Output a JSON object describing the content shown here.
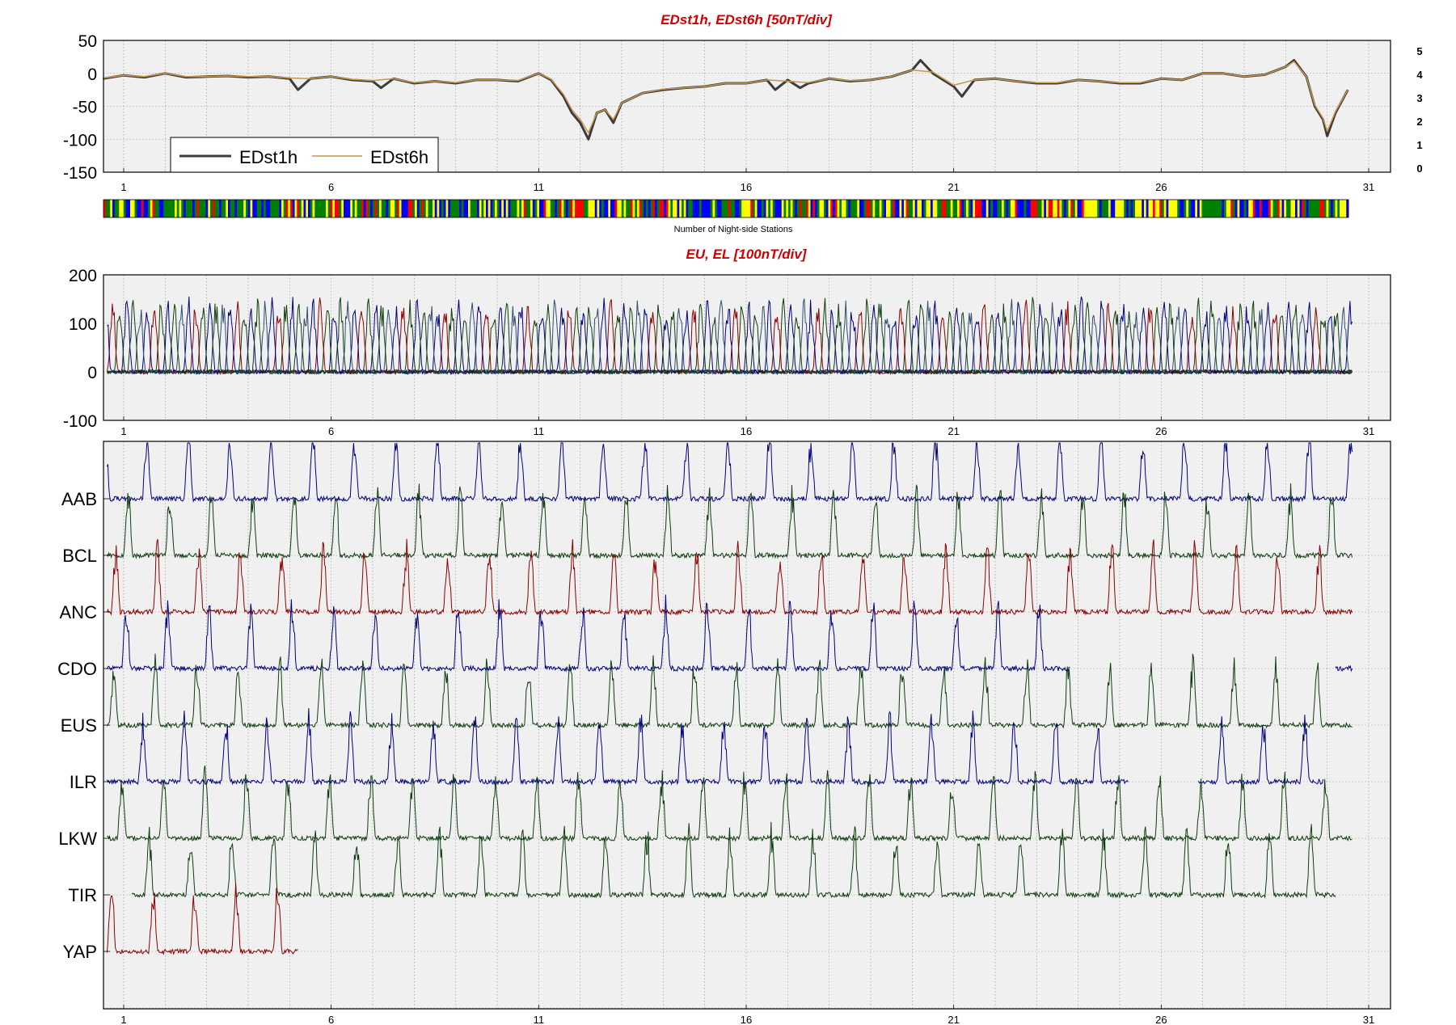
{
  "colors": {
    "frame": "#000000",
    "plot_bg": "#f0f0f0",
    "grid": "#8c8c8c",
    "title": "#d00000",
    "edst1h": "#3c3c3c",
    "edst6h": "#c8964b",
    "red_trace": "#8b0000",
    "blue_trace": "#000080",
    "green_trace": "#0f3d0f"
  },
  "chart_data": [
    {
      "id": "edst",
      "type": "line",
      "title": "EDst1h, EDst6h [50nT/div]",
      "xlabel": "",
      "ylabel": "",
      "xlim": [
        0,
        31
      ],
      "ylim": [
        -150,
        50
      ],
      "yticks": [
        50,
        0,
        -50,
        -100,
        -150
      ],
      "xticks": [
        1,
        6,
        11,
        16,
        21,
        26,
        31
      ],
      "grid": true,
      "legend": "bottom-left",
      "series": [
        {
          "name": "EDst1h",
          "color": "#3c3c3c",
          "x": [
            0.5,
            1,
            1.5,
            2,
            2.5,
            3,
            3.5,
            4,
            4.5,
            5,
            5.2,
            5.5,
            6,
            6.5,
            7,
            7.2,
            7.5,
            8,
            8.5,
            9,
            9.5,
            10,
            10.5,
            11,
            11.3,
            11.6,
            11.8,
            12,
            12.2,
            12.4,
            12.6,
            12.8,
            13,
            13.5,
            14,
            14.5,
            15,
            15.5,
            16,
            16.5,
            16.7,
            17,
            17.3,
            17.5,
            18,
            18.5,
            19,
            19.5,
            20,
            20.2,
            20.5,
            21,
            21.2,
            21.5,
            22,
            22.5,
            23,
            23.5,
            24,
            24.5,
            25,
            25.5,
            26,
            26.5,
            27,
            27.5,
            28,
            28.5,
            29,
            29.2,
            29.5,
            29.7,
            29.9,
            30,
            30.2,
            30.5
          ],
          "y": [
            -8,
            -3,
            -6,
            0,
            -6,
            -5,
            -4,
            -6,
            -5,
            -8,
            -25,
            -8,
            -5,
            -10,
            -12,
            -22,
            -8,
            -15,
            -12,
            -15,
            -10,
            -10,
            -12,
            0,
            -10,
            -35,
            -60,
            -75,
            -100,
            -60,
            -55,
            -75,
            -45,
            -30,
            -25,
            -22,
            -20,
            -15,
            -15,
            -10,
            -25,
            -10,
            -22,
            -15,
            -8,
            -12,
            -10,
            -5,
            5,
            20,
            0,
            -20,
            -35,
            -10,
            -8,
            -12,
            -15,
            -15,
            -10,
            -12,
            -15,
            -15,
            -8,
            -10,
            0,
            0,
            -5,
            -2,
            10,
            20,
            -5,
            -50,
            -70,
            -95,
            -60,
            -25
          ]
        },
        {
          "name": "EDst6h",
          "color": "#c8964b",
          "x": [
            0.5,
            1,
            1.5,
            2,
            2.5,
            3,
            3.5,
            4,
            4.5,
            5,
            5.5,
            6,
            6.5,
            7,
            7.5,
            8,
            8.5,
            9,
            9.5,
            10,
            10.5,
            11,
            11.3,
            11.6,
            11.8,
            12,
            12.2,
            12.4,
            12.6,
            12.8,
            13,
            13.5,
            14,
            14.5,
            15,
            15.5,
            16,
            16.5,
            17,
            17.5,
            18,
            18.5,
            19,
            19.5,
            20,
            20.5,
            21,
            21.5,
            22,
            22.5,
            23,
            23.5,
            24,
            24.5,
            25,
            25.5,
            26,
            26.5,
            27,
            27.5,
            28,
            28.5,
            29,
            29.2,
            29.5,
            29.7,
            29.9,
            30,
            30.2,
            30.5
          ],
          "y": [
            -7,
            -3,
            -5,
            0,
            -5,
            -5,
            -4,
            -5,
            -5,
            -7,
            -8,
            -5,
            -9,
            -11,
            -8,
            -14,
            -12,
            -14,
            -10,
            -10,
            -11,
            0,
            -9,
            -32,
            -55,
            -70,
            -90,
            -60,
            -55,
            -70,
            -45,
            -30,
            -24,
            -22,
            -20,
            -15,
            -15,
            -10,
            -12,
            -14,
            -8,
            -11,
            -10,
            -5,
            5,
            2,
            -18,
            -10,
            -8,
            -12,
            -14,
            -14,
            -10,
            -12,
            -14,
            -14,
            -8,
            -10,
            0,
            0,
            -5,
            -2,
            10,
            18,
            -5,
            -48,
            -68,
            -88,
            -58,
            -25
          ]
        }
      ]
    },
    {
      "id": "night-stations",
      "type": "heatmap",
      "xlabel": "Number of Night-side Stations",
      "legend": "right",
      "levels": [
        {
          "label": "5",
          "color": "#ff0000"
        },
        {
          "label": "4",
          "color": "#ffff00"
        },
        {
          "label": "3",
          "color": "#008000"
        },
        {
          "label": "2",
          "color": "#0000ff"
        },
        {
          "label": "1",
          "color": "#800080"
        },
        {
          "label": "0",
          "color": "#000000"
        }
      ]
    },
    {
      "id": "eu-el",
      "type": "line",
      "title": "EU, EL   [100nT/div]",
      "xlim": [
        0,
        31
      ],
      "ylim": [
        -100,
        200
      ],
      "yticks": [
        200,
        100,
        0,
        -100
      ],
      "xticks": [
        1,
        6,
        11,
        16,
        21,
        26,
        31
      ],
      "grid": true
    },
    {
      "id": "stations",
      "type": "line",
      "xlim": [
        0,
        31
      ],
      "xticks": [
        1,
        6,
        11,
        16,
        21,
        26,
        31
      ],
      "grid": true,
      "stations": [
        {
          "label": "AAB",
          "color": "#000080",
          "phase": 0.55,
          "coverage": [
            [
              0,
              30
            ]
          ]
        },
        {
          "label": "BCL",
          "color": "#0f3d0f",
          "phase": 0.0,
          "coverage": [
            [
              0,
              30
            ]
          ]
        },
        {
          "label": "ANC",
          "color": "#8b0000",
          "phase": 0.3,
          "coverage": [
            [
              0,
              30
            ]
          ]
        },
        {
          "label": "CDO",
          "color": "#000080",
          "phase": 0.05,
          "coverage": [
            [
              0,
              23.2
            ],
            [
              29.6,
              30
            ]
          ]
        },
        {
          "label": "EUS",
          "color": "#0f3d0f",
          "phase": 0.35,
          "coverage": [
            [
              0,
              30
            ]
          ]
        },
        {
          "label": "ILR",
          "color": "#000080",
          "phase": 0.65,
          "coverage": [
            [
              0,
              24.6
            ],
            [
              26.3,
              29.3
            ]
          ]
        },
        {
          "label": "LKW",
          "color": "#0f3d0f",
          "phase": 0.15,
          "coverage": [
            [
              0,
              30
            ]
          ]
        },
        {
          "label": "TIR",
          "color": "#0f3d0f",
          "phase": 0.5,
          "coverage": [
            [
              0.6,
              29.6
            ]
          ]
        },
        {
          "label": "YAP",
          "color": "#8b0000",
          "phase": 0.4,
          "coverage": [
            [
              0,
              4.6
            ]
          ]
        }
      ]
    }
  ]
}
